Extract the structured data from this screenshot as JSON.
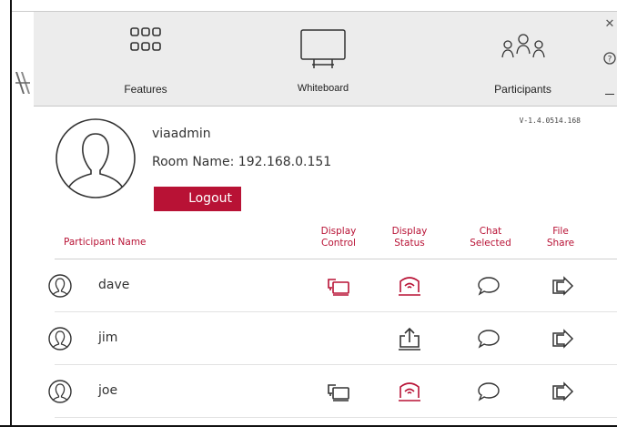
{
  "colors": {
    "accent": "#b81235",
    "toolbar_bg": "#ececec",
    "icon_dark": "#333333"
  },
  "toolbar": {
    "features_label": "Features",
    "whiteboard_label": "Whiteboard",
    "participants_label": "Participants"
  },
  "window": {
    "close_icon": "close-icon",
    "help_icon": "help-icon",
    "minimize_icon": "minimize-icon"
  },
  "user": {
    "name": "viaadmin",
    "room": "Room Name: 192.168.0.151",
    "logout_label": "Logout",
    "version": "V-1.4.0514.168"
  },
  "table": {
    "headers": {
      "name": "Participant Name",
      "display_control": [
        "Display",
        "Control"
      ],
      "display_status": [
        "Display",
        "Status"
      ],
      "chat_selected": [
        "Chat",
        "Selected"
      ],
      "file_share": [
        "File",
        "Share"
      ]
    },
    "rows": [
      {
        "name": "dave",
        "display_control": "active",
        "display_status": "presenting"
      },
      {
        "name": "jim",
        "display_control": "none",
        "display_status": "share"
      },
      {
        "name": "joe",
        "display_control": "inactive",
        "display_status": "presenting"
      }
    ]
  }
}
